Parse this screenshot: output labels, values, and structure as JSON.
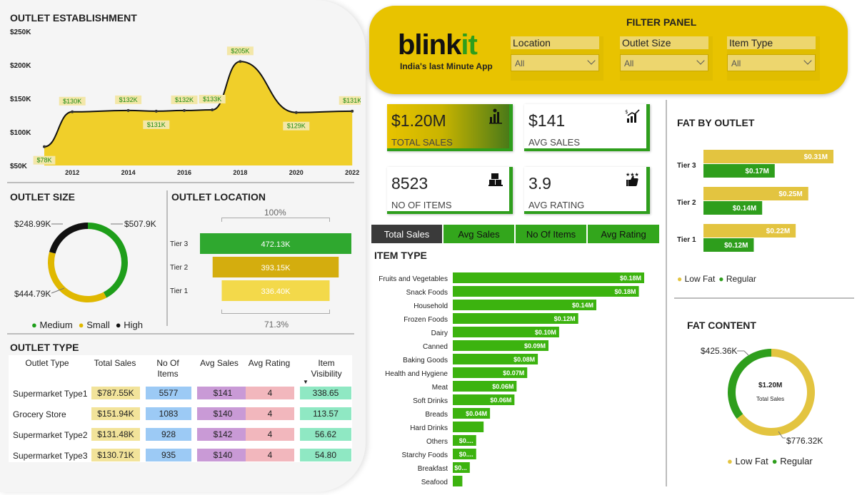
{
  "outlet_establishment": {
    "title": "OUTLET ESTABLISHMENT",
    "y_ticks": [
      "$250K",
      "$200K",
      "$150K",
      "$100K",
      "$50K"
    ],
    "x_ticks": [
      "2012",
      "2014",
      "2016",
      "2018",
      "2020",
      "2022"
    ]
  },
  "outlet_size": {
    "title": "OUTLET SIZE",
    "legend": [
      {
        "label": "Medium",
        "color": "#1e9e1a"
      },
      {
        "label": "Small",
        "color": "#e0b800"
      },
      {
        "label": "High",
        "color": "#111111"
      }
    ],
    "labels": {
      "medium": "$507.9K",
      "small": "$444.79K",
      "high": "$248.99K"
    }
  },
  "outlet_location": {
    "title": "OUTLET LOCATION",
    "top_pct": "100%",
    "bottom_pct": "71.3%"
  },
  "outlet_type": {
    "title": "OUTLET TYPE",
    "headers": [
      "Outlet Type",
      "Total Sales",
      "No Of Items",
      "Avg Sales",
      "Avg Rating",
      "Item Visibility"
    ],
    "rows": [
      {
        "name": "Supermarket Type1",
        "sales": "$787.55K",
        "items": "5577",
        "avg": "$141",
        "rating": "4",
        "vis": "338.65"
      },
      {
        "name": "Grocery Store",
        "sales": "$151.94K",
        "items": "1083",
        "avg": "$140",
        "rating": "4",
        "vis": "113.57"
      },
      {
        "name": "Supermarket Type2",
        "sales": "$131.48K",
        "items": "928",
        "avg": "$142",
        "rating": "4",
        "vis": "56.62"
      },
      {
        "name": "Supermarket Type3",
        "sales": "$130.71K",
        "items": "935",
        "avg": "$140",
        "rating": "4",
        "vis": "54.80"
      }
    ]
  },
  "filter_panel": {
    "title": "FILTER PANEL",
    "logo_main": "blink",
    "logo_accent": "it",
    "tagline": "India's last Minute App",
    "filters": [
      {
        "label": "Location",
        "value": "All"
      },
      {
        "label": "Outlet Size",
        "value": "All"
      },
      {
        "label": "Item Type",
        "value": "All"
      }
    ]
  },
  "kpis": [
    {
      "value": "$1.20M",
      "label": "TOTAL SALES",
      "icon": "bar-chart-icon"
    },
    {
      "value": "$141",
      "label": "AVG SALES",
      "icon": "growth-chart-icon"
    },
    {
      "value": "8523",
      "label": "NO OF ITEMS",
      "icon": "boxes-icon"
    },
    {
      "value": "3.9",
      "label": "AVG RATING",
      "icon": "thumbs-up-stars-icon"
    }
  ],
  "tabs": [
    "Total Sales",
    "Avg Sales",
    "No Of Items",
    "Avg Rating"
  ],
  "item_type": {
    "title": "ITEM TYPE"
  },
  "fat_by_outlet": {
    "title": "FAT BY OUTLET",
    "legend": [
      "Low Fat",
      "Regular"
    ]
  },
  "fat_content": {
    "title": "FAT CONTENT",
    "center_value": "$1.20M",
    "center_label": "Total Sales",
    "regular_label": "$425.36K",
    "lowfat_label": "$776.32K",
    "legend": [
      "Low Fat",
      "Regular"
    ]
  },
  "colors": {
    "yellow": "#e8c300",
    "green": "#2e9e1c",
    "bright_green": "#3cb30f",
    "light_yellow": "#f0d23c"
  },
  "chart_data": [
    {
      "type": "area",
      "title": "OUTLET ESTABLISHMENT",
      "x": [
        2011,
        2012,
        2014,
        2015,
        2016,
        2017,
        2018,
        2020,
        2022
      ],
      "values": [
        78,
        130,
        132,
        131,
        132,
        133,
        205,
        129,
        131
      ],
      "labels": [
        "$78K",
        "$130K",
        "$132K",
        "$131K",
        "$132K",
        "$133K",
        "$205K",
        "$129K",
        "$131K"
      ],
      "ylim": [
        50,
        250
      ]
    },
    {
      "type": "pie",
      "title": "OUTLET SIZE",
      "categories": [
        "Medium",
        "Small",
        "High"
      ],
      "values": [
        507.9,
        444.79,
        248.99
      ]
    },
    {
      "type": "bar",
      "title": "OUTLET LOCATION",
      "categories": [
        "Tier 3",
        "Tier 2",
        "Tier 1"
      ],
      "values": [
        472.13,
        393.15,
        336.4
      ],
      "labels": [
        "472.13K",
        "393.15K",
        "336.40K"
      ]
    },
    {
      "type": "bar",
      "title": "ITEM TYPE",
      "categories": [
        "Fruits and Vegetables",
        "Snack Foods",
        "Household",
        "Frozen Foods",
        "Dairy",
        "Canned",
        "Baking Goods",
        "Health and Hygiene",
        "Meat",
        "Soft Drinks",
        "Breads",
        "Hard Drinks",
        "Others",
        "Starchy Foods",
        "Breakfast",
        "Seafood"
      ],
      "values": [
        0.18,
        0.175,
        0.135,
        0.118,
        0.1,
        0.09,
        0.08,
        0.07,
        0.06,
        0.058,
        0.035,
        0.029,
        0.022,
        0.022,
        0.016,
        0.009
      ],
      "labels": [
        "$0.18M",
        "$0.18M",
        "$0.14M",
        "$0.12M",
        "$0.10M",
        "$0.09M",
        "$0.08M",
        "$0.07M",
        "$0.06M",
        "$0.06M",
        "$0.04M",
        "",
        "$0....",
        "$0....",
        "$0...",
        ""
      ]
    },
    {
      "type": "bar",
      "title": "FAT BY OUTLET",
      "categories": [
        "Tier 3",
        "Tier 2",
        "Tier 1"
      ],
      "series": [
        {
          "name": "Low Fat",
          "values": [
            0.31,
            0.25,
            0.22
          ],
          "labels": [
            "$0.31M",
            "$0.25M",
            "$0.22M"
          ]
        },
        {
          "name": "Regular",
          "values": [
            0.17,
            0.14,
            0.12
          ],
          "labels": [
            "$0.17M",
            "$0.14M",
            "$0.12M"
          ]
        }
      ]
    },
    {
      "type": "pie",
      "title": "FAT CONTENT",
      "categories": [
        "Low Fat",
        "Regular"
      ],
      "values": [
        776.32,
        425.36
      ]
    }
  ]
}
